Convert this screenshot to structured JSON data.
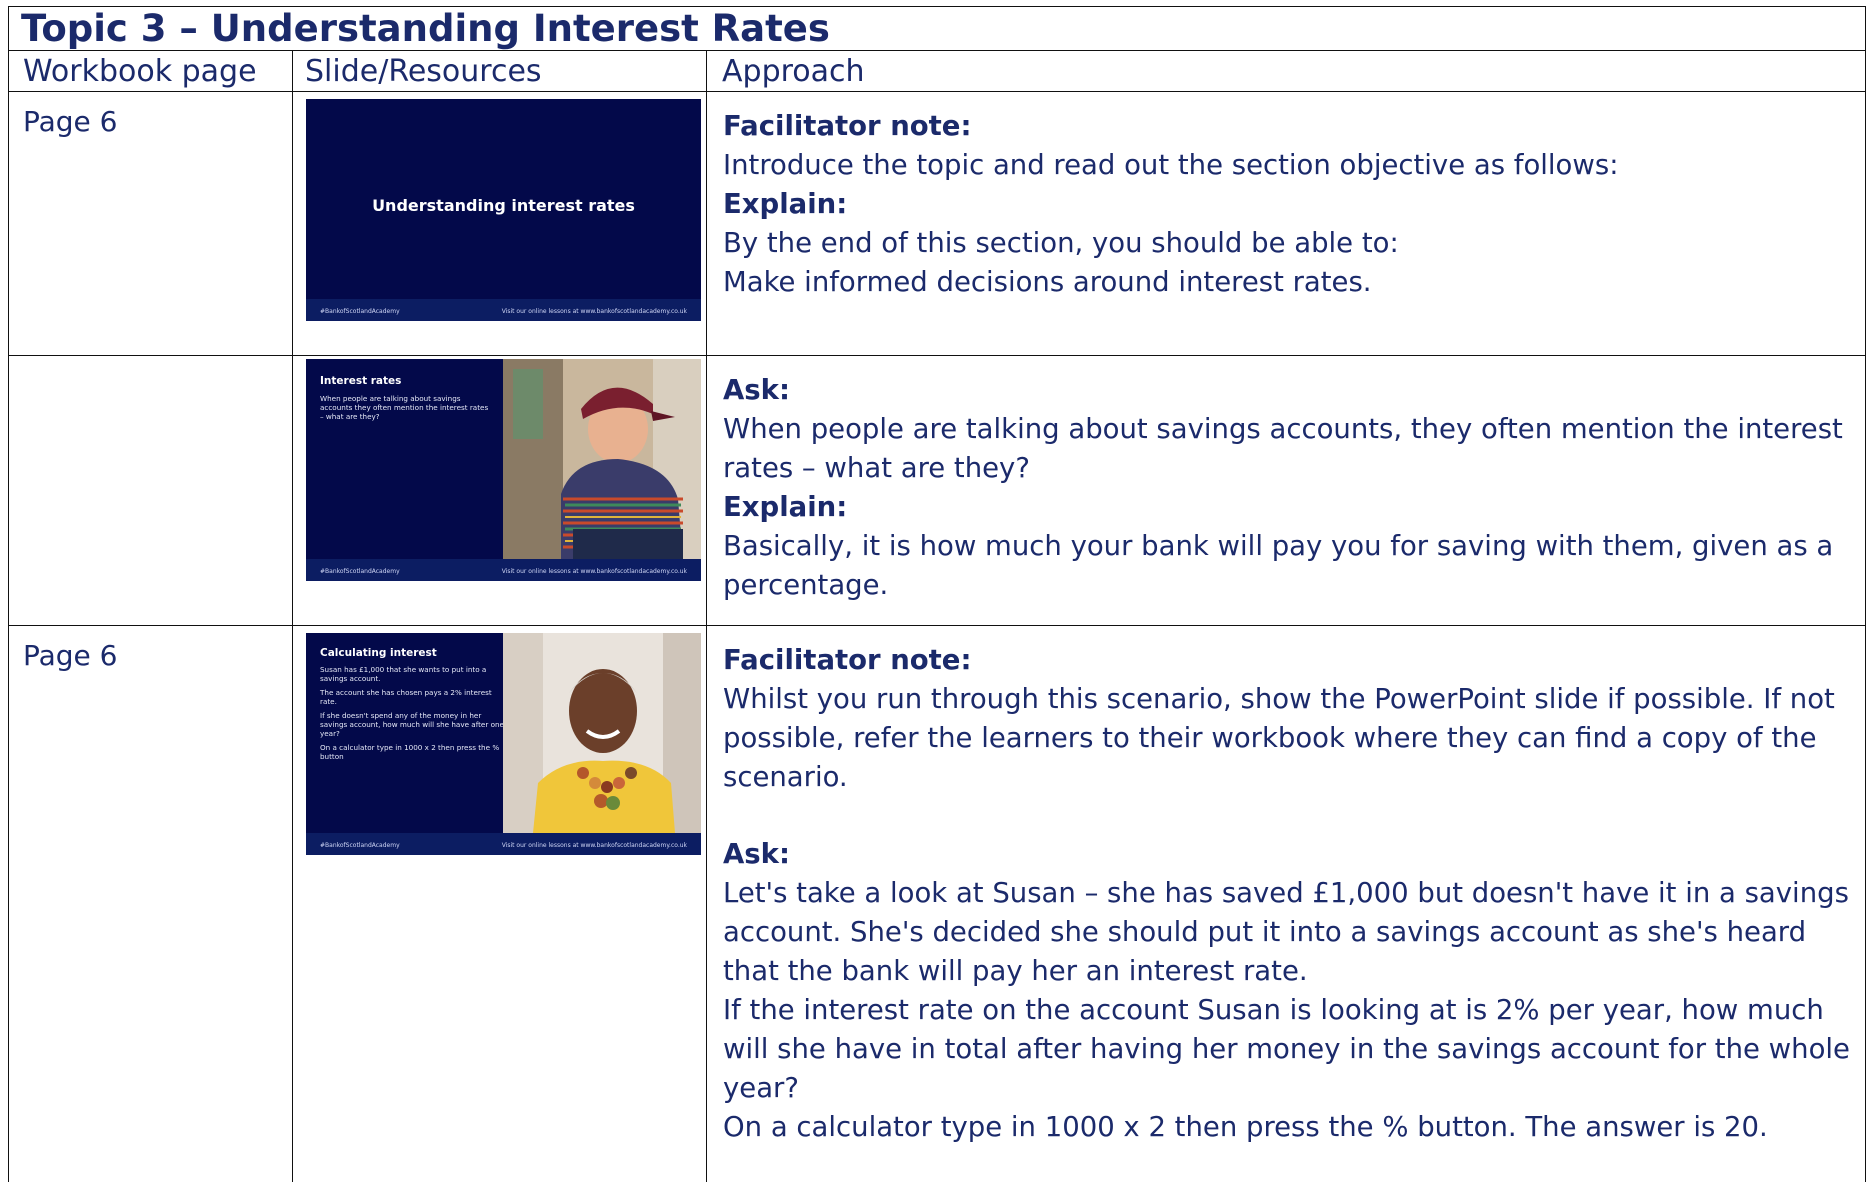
{
  "title": "Topic 3 – Understanding Interest Rates",
  "headers": {
    "workbook_page": "Workbook page",
    "slide_resources": "Slide/Resources",
    "approach": "Approach"
  },
  "rows": [
    {
      "page": "Page 6",
      "slide": {
        "title": "Understanding interest rates",
        "footer_left": "#BankofScotlandAcademy",
        "footer_right": "Visit our online lessons at www.bankofscotlandacademy.co.uk"
      },
      "approach": [
        {
          "bold": true,
          "text": "Facilitator note:"
        },
        {
          "bold": false,
          "text": "Introduce the topic and read out the section objective as follows:"
        },
        {
          "bold": true,
          "text": "Explain:"
        },
        {
          "bold": false,
          "text": "By the end of this section, you should be able to:"
        },
        {
          "bold": false,
          "text": "Make informed decisions around interest rates."
        }
      ]
    },
    {
      "page": "",
      "slide": {
        "title": "Interest rates",
        "body": "When people are talking about savings accounts they often mention the interest rates – what are they?",
        "footer_left": "#BankofScotlandAcademy",
        "footer_right": "Visit our online lessons at www.bankofscotlandacademy.co.uk"
      },
      "approach": [
        {
          "bold": true,
          "text": "Ask:"
        },
        {
          "bold": false,
          "text": "When people are talking about savings accounts, they often mention the interest rates – what are they?"
        },
        {
          "bold": true,
          "text": "Explain:"
        },
        {
          "bold": false,
          "text": "Basically, it is how much your bank will pay you for saving with them, given as a percentage."
        }
      ]
    },
    {
      "page": "Page 6",
      "slide": {
        "title": "Calculating interest",
        "body_lines": [
          "Susan has £1,000 that she wants to put into a savings account.",
          "The account she has chosen pays a 2% interest rate.",
          "If she doesn't spend any of the money in her savings account, how much will she have after one year?",
          "On a calculator type in 1000 x 2 then press the % button"
        ],
        "footer_left": "#BankofScotlandAcademy",
        "footer_right": "Visit our online lessons at www.bankofscotlandacademy.co.uk"
      },
      "approach": [
        {
          "bold": true,
          "text": "Facilitator note:"
        },
        {
          "bold": false,
          "text": "Whilst you run through this scenario, show the PowerPoint slide if possible. If not possible, refer the learners to their workbook where they can find a copy of the scenario."
        },
        {
          "bold": true,
          "text": "Ask:"
        },
        {
          "bold": false,
          "text": "Let's take a look at Susan – she has saved £1,000 but doesn't have it in a savings account. She's decided she should put it into a savings account as she's heard that the bank will pay her an interest rate."
        },
        {
          "bold": false,
          "text": "If the interest rate on the account Susan is looking at is 2% per year, how much will she have in total after having her money in the savings account for the whole year?"
        },
        {
          "bold": false,
          "text": "On a calculator type in 1000 x 2 then press the % button. The answer is 20."
        }
      ]
    }
  ]
}
